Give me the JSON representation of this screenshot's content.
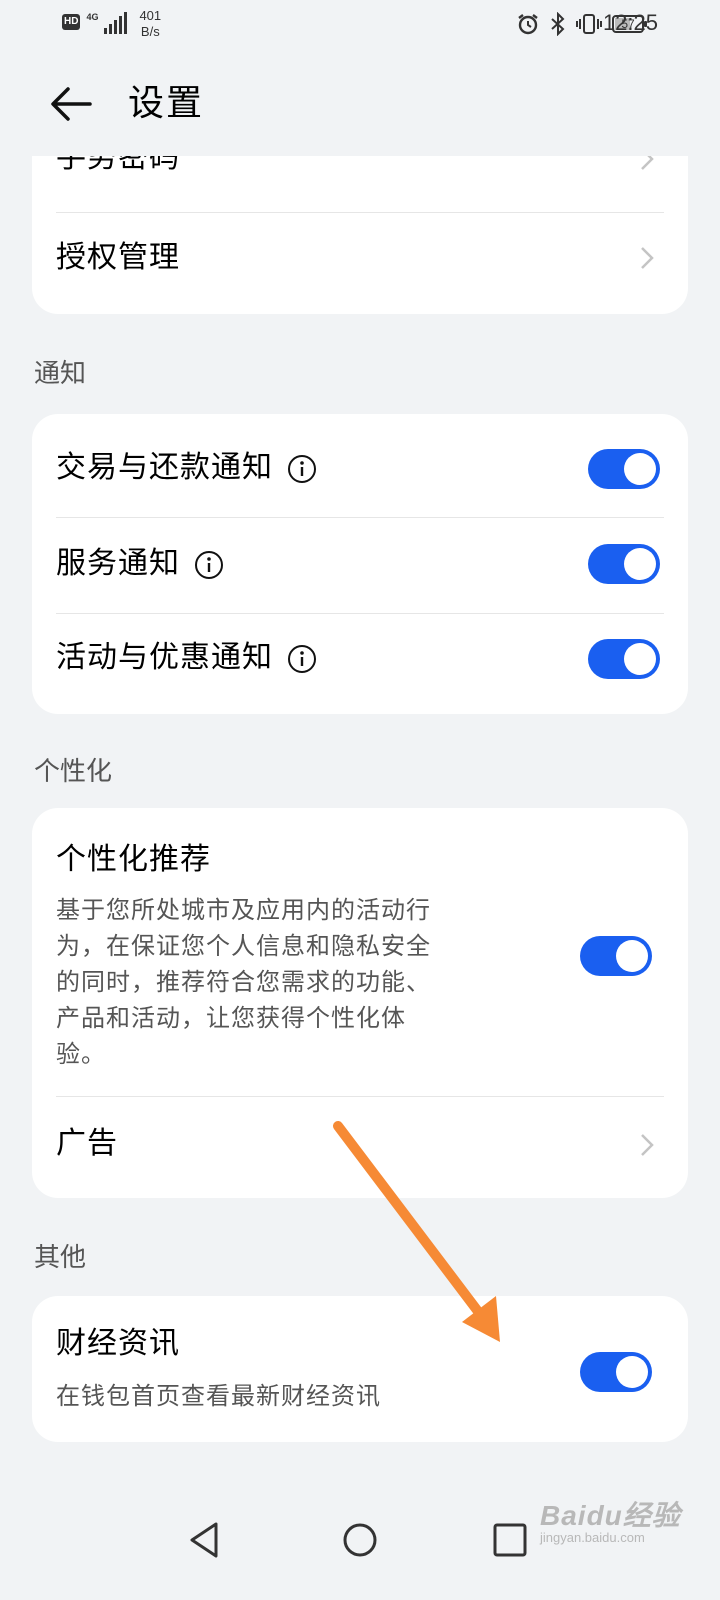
{
  "status_bar": {
    "hd": "HD",
    "network": "4G",
    "data_rate": "401",
    "data_rate_unit": "B/s",
    "battery": "57",
    "time": "12:25"
  },
  "header": {
    "title": "设置"
  },
  "security_card": {
    "gesture_password": "手势密码",
    "authorization": "授权管理"
  },
  "notifications": {
    "section_title": "通知",
    "items": [
      {
        "label": "交易与还款通知",
        "enabled": true
      },
      {
        "label": "服务通知",
        "enabled": true
      },
      {
        "label": "活动与优惠通知",
        "enabled": true
      }
    ]
  },
  "personalization": {
    "section_title": "个性化",
    "recommend_title": "个性化推荐",
    "recommend_desc_lines": [
      "基于您所处城市及应用内的活动行",
      "为，在保证您个人信息和隐私安全",
      "的同时，推荐符合您需求的功能、",
      "产品和活动，让您获得个性化体",
      "验。"
    ],
    "recommend_enabled": true,
    "ads": "广告"
  },
  "others": {
    "section_title": "其他",
    "finance_title": "财经资讯",
    "finance_desc": "在钱包首页查看最新财经资讯",
    "finance_enabled": true
  },
  "watermark": {
    "main": "Baidu经验",
    "sub": "jingyan.baidu.com"
  },
  "colors": {
    "toggle_on": "#1a5ff0",
    "annotation_arrow": "#f68a35",
    "background": "#f1f3f5"
  }
}
